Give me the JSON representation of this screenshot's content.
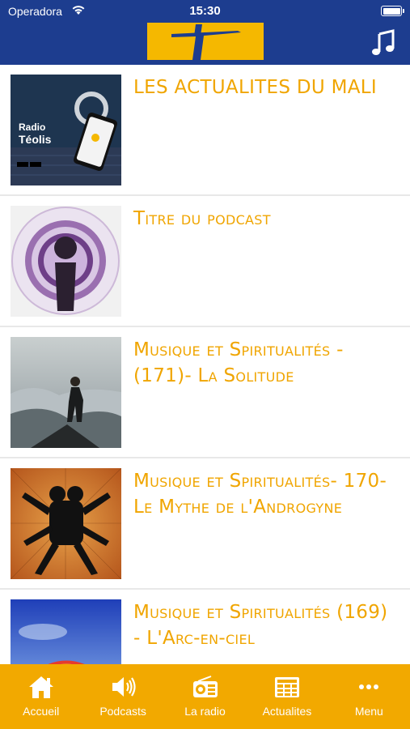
{
  "status_bar": {
    "carrier": "Operadora",
    "time": "15:30"
  },
  "header": {
    "logo_icon": "cross-logo",
    "music_icon": "music-note-icon"
  },
  "colors": {
    "header_bg": "#1d3d8f",
    "accent": "#f2a900",
    "title_text": "#f0a500"
  },
  "items": [
    {
      "title": "LES ACTUALITES DU MALI",
      "thumb_text_1": "Radio",
      "thumb_text_2": "Téolis"
    },
    {
      "title": "Titre du podcast"
    },
    {
      "title": "Musique et Spiritualités - (171)- La Solitude"
    },
    {
      "title": "Musique et Spiritualités- 170- Le Mythe de l'Androgyne"
    },
    {
      "title": "Musique et Spiritualités (169) - L'Arc-en-ciel"
    }
  ],
  "tabs": [
    {
      "label": "Accueil",
      "icon": "home-icon"
    },
    {
      "label": "Podcasts",
      "icon": "speaker-icon"
    },
    {
      "label": "La radio",
      "icon": "radio-icon"
    },
    {
      "label": "Actualites",
      "icon": "newspaper-icon"
    },
    {
      "label": "Menu",
      "icon": "more-icon"
    }
  ]
}
